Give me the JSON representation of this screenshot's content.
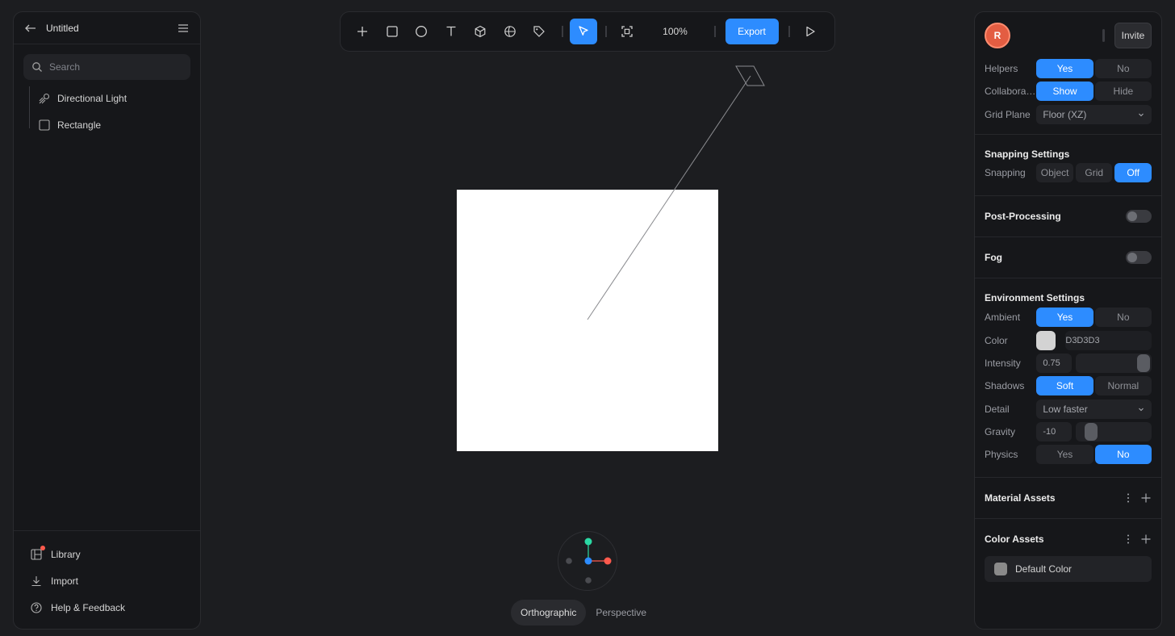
{
  "left_panel": {
    "title": "Untitled",
    "search_placeholder": "Search",
    "layers": [
      {
        "label": "Directional Light",
        "icon": "directional-light-icon"
      },
      {
        "label": "Rectangle",
        "icon": "rectangle-icon"
      }
    ],
    "footer": [
      {
        "label": "Library",
        "icon": "library-icon"
      },
      {
        "label": "Import",
        "icon": "import-icon"
      },
      {
        "label": "Help & Feedback",
        "icon": "help-icon"
      }
    ]
  },
  "toolbar": {
    "zoom": "100%",
    "export_label": "Export"
  },
  "view": {
    "orthographic": "Orthographic",
    "perspective": "Perspective"
  },
  "right_panel": {
    "avatar_letter": "R",
    "invite_label": "Invite",
    "helpers": {
      "label": "Helpers",
      "yes": "Yes",
      "no": "No"
    },
    "collaborators": {
      "label": "Collaborators",
      "show": "Show",
      "hide": "Hide"
    },
    "grid_plane": {
      "label": "Grid Plane",
      "value": "Floor (XZ)"
    },
    "snapping_settings": {
      "title": "Snapping Settings",
      "label": "Snapping",
      "object": "Object",
      "grid": "Grid",
      "off": "Off"
    },
    "post_processing": {
      "title": "Post-Processing"
    },
    "fog": {
      "title": "Fog"
    },
    "environment": {
      "title": "Environment Settings",
      "ambient": {
        "label": "Ambient",
        "yes": "Yes",
        "no": "No"
      },
      "color": {
        "label": "Color",
        "hex": "D3D3D3"
      },
      "intensity": {
        "label": "Intensity",
        "value": "0.75"
      },
      "shadows": {
        "label": "Shadows",
        "soft": "Soft",
        "normal": "Normal"
      },
      "detail": {
        "label": "Detail",
        "value": "Low faster"
      },
      "gravity": {
        "label": "Gravity",
        "value": "-10"
      },
      "physics": {
        "label": "Physics",
        "yes": "Yes",
        "no": "No"
      }
    },
    "material_assets": {
      "title": "Material Assets"
    },
    "color_assets": {
      "title": "Color Assets",
      "default_color": "Default Color"
    }
  },
  "colors": {
    "accent": "#2d8cff",
    "panel_bg": "#16171a",
    "canvas_bg": "#1c1d20",
    "avatar": "#e35d42",
    "color_swatch": "#D3D3D3"
  }
}
